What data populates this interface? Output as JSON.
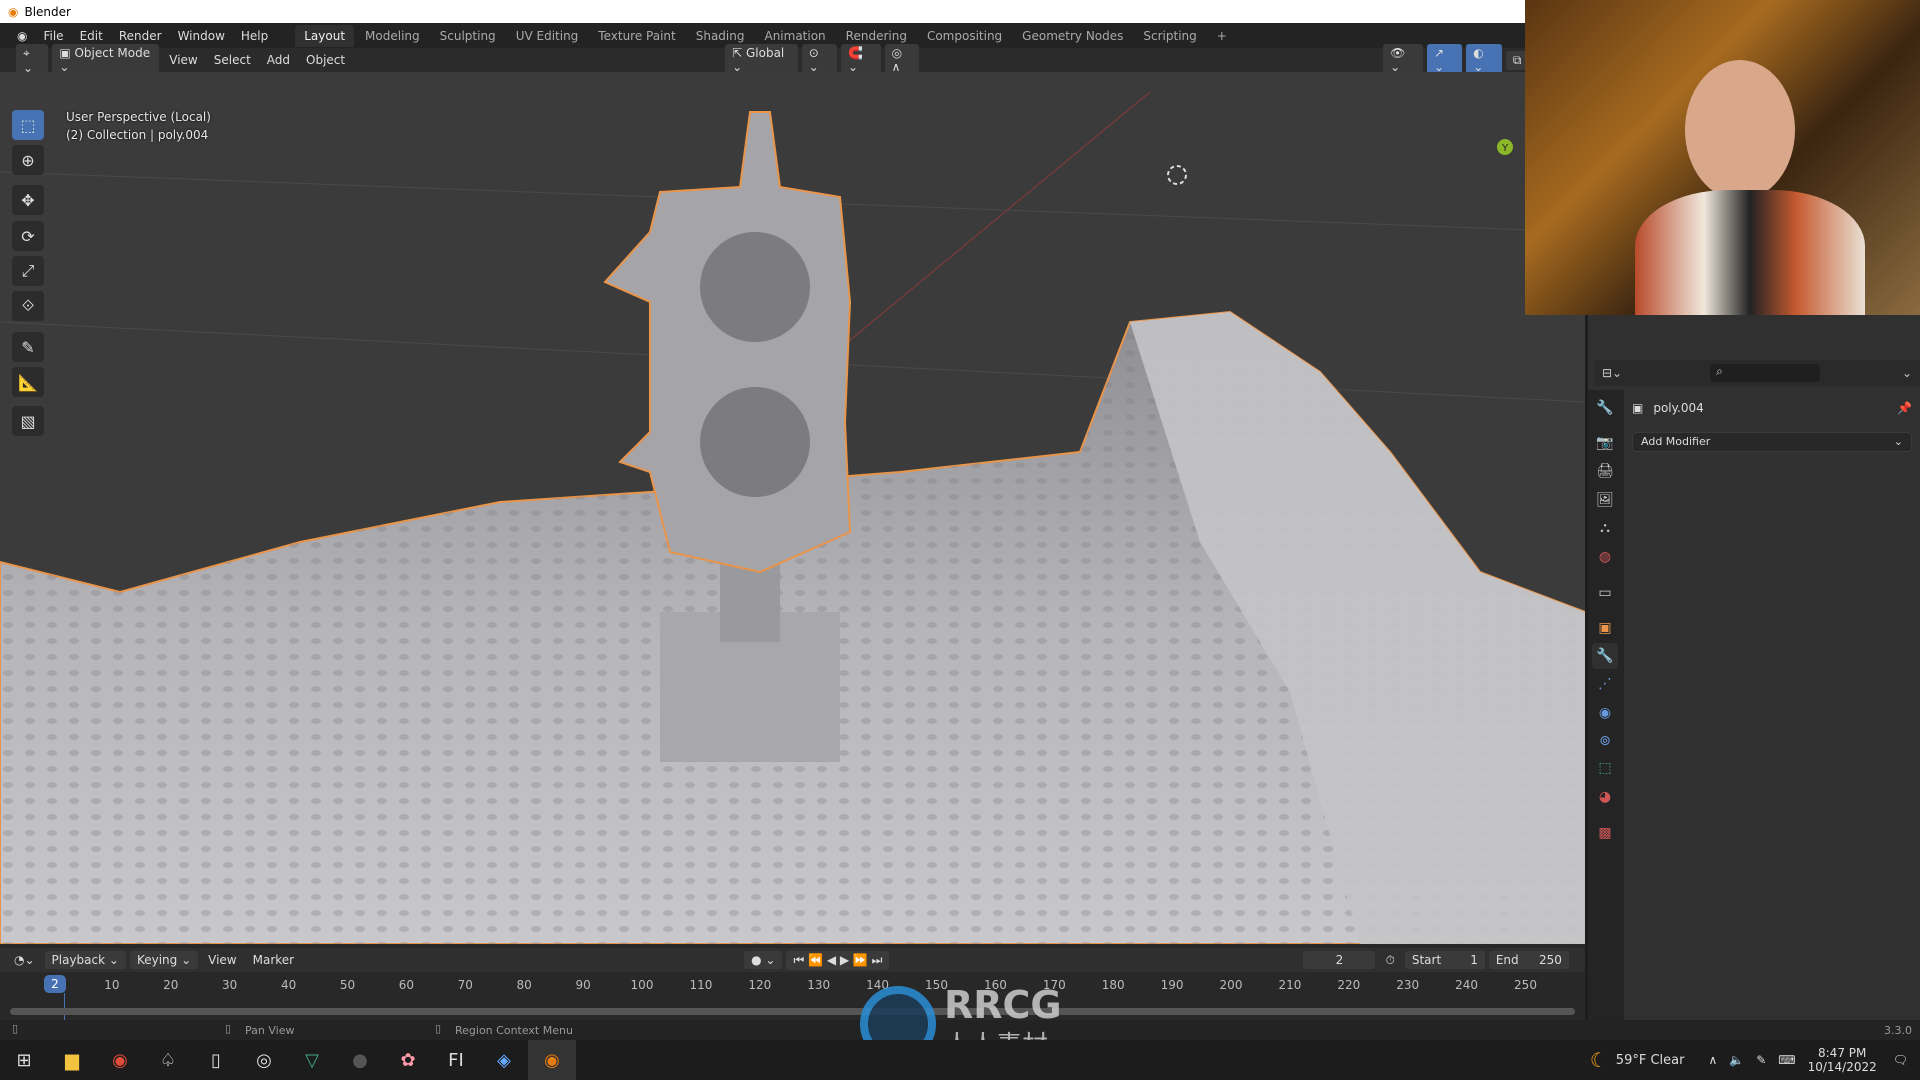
{
  "window": {
    "title": "Blender"
  },
  "menu": [
    "File",
    "Edit",
    "Render",
    "Window",
    "Help"
  ],
  "workspaces": [
    "Layout",
    "Modeling",
    "Sculpting",
    "UV Editing",
    "Texture Paint",
    "Shading",
    "Animation",
    "Rendering",
    "Compositing",
    "Geometry Nodes",
    "Scripting",
    "+"
  ],
  "active_workspace": "Layout",
  "viewport_header": {
    "mode": "Object Mode",
    "menus": [
      "View",
      "Select",
      "Add",
      "Object"
    ],
    "orientation": "Global"
  },
  "viewport": {
    "view_name": "User Perspective (Local)",
    "collection": "(2) Collection | poly.004",
    "selection_outline_color": "#e8944a",
    "background_color": "#3b3b3b",
    "mesh_color": "#b9b9bc",
    "gizmo_axis": "Y"
  },
  "tools": [
    "select-box",
    "cursor",
    "move",
    "rotate",
    "scale",
    "transform",
    "annotate",
    "measure",
    "add-cube"
  ],
  "properties": {
    "object_name": "poly.004",
    "add_modifier_label": "Add Modifier",
    "active_tab": "modifiers",
    "tabs": [
      "tool",
      "render",
      "output",
      "view-layer",
      "scene",
      "world",
      "collection",
      "object",
      "modifiers",
      "particles",
      "physics",
      "constraints",
      "data",
      "material",
      "texture"
    ]
  },
  "timeline": {
    "menus": [
      "Playback",
      "Keying",
      "View",
      "Marker"
    ],
    "current_frame": "2",
    "start_label": "Start",
    "start": "1",
    "end_label": "End",
    "end": "250",
    "ticks": [
      "10",
      "20",
      "30",
      "40",
      "50",
      "60",
      "70",
      "80",
      "90",
      "100",
      "110",
      "120",
      "130",
      "140",
      "150",
      "160",
      "170",
      "180",
      "190",
      "200",
      "210",
      "220",
      "230",
      "240",
      "250"
    ]
  },
  "statusbar": {
    "pan": "Pan View",
    "context": "Region Context Menu",
    "version": "3.3.0"
  },
  "watermark": {
    "text": "RRCG",
    "subtext": "人人素材"
  },
  "taskbar": {
    "weather": "59°F  Clear",
    "time": "8:47 PM",
    "date": "10/14/2022"
  }
}
